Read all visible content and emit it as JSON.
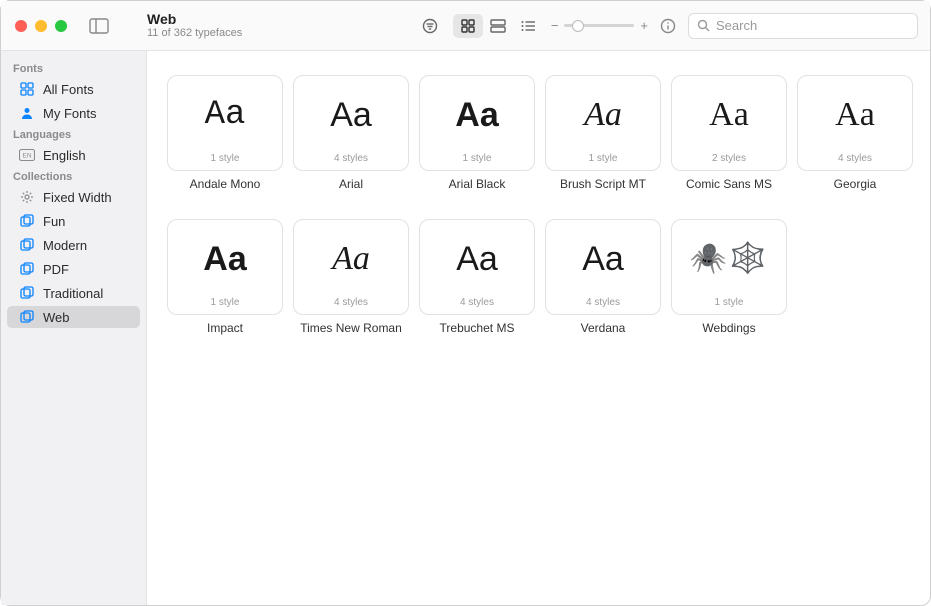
{
  "header": {
    "title": "Web",
    "subtitle": "11 of 362 typefaces",
    "search_placeholder": "Search"
  },
  "sidebar": {
    "sections": [
      {
        "label": "Fonts",
        "items": [
          {
            "label": "All Fonts",
            "icon": "font-grid-icon"
          },
          {
            "label": "My Fonts",
            "icon": "user-icon"
          }
        ]
      },
      {
        "label": "Languages",
        "items": [
          {
            "label": "English",
            "icon": "language-icon"
          }
        ]
      },
      {
        "label": "Collections",
        "items": [
          {
            "label": "Fixed Width",
            "icon": "gear-icon"
          },
          {
            "label": "Fun",
            "icon": "collection-icon"
          },
          {
            "label": "Modern",
            "icon": "collection-icon"
          },
          {
            "label": "PDF",
            "icon": "collection-icon"
          },
          {
            "label": "Traditional",
            "icon": "collection-icon"
          },
          {
            "label": "Web",
            "icon": "collection-icon",
            "selected": true
          }
        ]
      }
    ]
  },
  "fonts": [
    {
      "name": "Andale Mono",
      "styles": "1 style",
      "sample": "Aa",
      "class": "f-andale"
    },
    {
      "name": "Arial",
      "styles": "4 styles",
      "sample": "Aa",
      "class": "f-arial"
    },
    {
      "name": "Arial Black",
      "styles": "1 style",
      "sample": "Aa",
      "class": "f-arialblk"
    },
    {
      "name": "Brush Script MT",
      "styles": "1 style",
      "sample": "Aa",
      "class": "f-brush"
    },
    {
      "name": "Comic Sans MS",
      "styles": "2 styles",
      "sample": "Aa",
      "class": "f-comic"
    },
    {
      "name": "Georgia",
      "styles": "4 styles",
      "sample": "Aa",
      "class": "f-georgia"
    },
    {
      "name": "Impact",
      "styles": "1 style",
      "sample": "Aa",
      "class": "f-impact"
    },
    {
      "name": "Times New Roman",
      "styles": "4 styles",
      "sample": "Aa",
      "class": "f-times"
    },
    {
      "name": "Trebuchet MS",
      "styles": "4 styles",
      "sample": "Aa",
      "class": "f-trebuchet"
    },
    {
      "name": "Verdana",
      "styles": "4 styles",
      "sample": "Aa",
      "class": "f-verdana"
    },
    {
      "name": "Webdings",
      "styles": "1 style",
      "sample": "🕷️🕸️",
      "class": "f-webdings"
    }
  ]
}
